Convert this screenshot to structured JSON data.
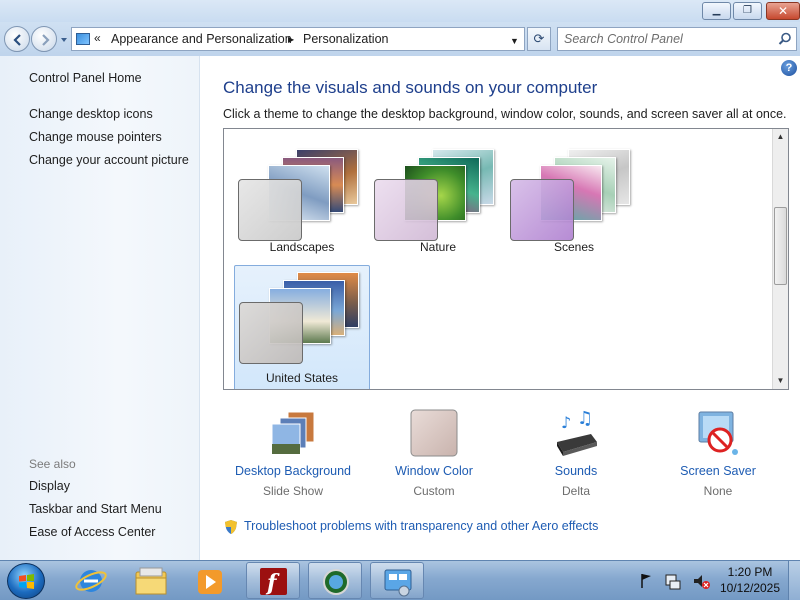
{
  "window": {
    "minimize_glyph": "▁",
    "maximize_glyph": "❐",
    "close_glyph": "✕"
  },
  "address_bar": {
    "chevrons": "«",
    "breadcrumb": [
      "Appearance and Personalization",
      "Personalization"
    ]
  },
  "search": {
    "placeholder": "Search Control Panel"
  },
  "sidebar": {
    "home": "Control Panel Home",
    "tasks": [
      "Change desktop icons",
      "Change mouse pointers",
      "Change your account picture"
    ],
    "see_also_title": "See also",
    "see_also": [
      "Display",
      "Taskbar and Start Menu",
      "Ease of Access Center"
    ]
  },
  "main": {
    "heading": "Change the visuals and sounds on your computer",
    "subtext": "Click a theme to change the desktop background, window color, sounds, and screen saver all at once.",
    "themes": [
      {
        "name": "Landscapes",
        "selected": false
      },
      {
        "name": "Nature",
        "selected": false
      },
      {
        "name": "Scenes",
        "selected": false
      },
      {
        "name": "United States",
        "selected": true
      }
    ],
    "options": [
      {
        "name": "Desktop Background",
        "value": "Slide Show",
        "icon": "desktop-background-icon"
      },
      {
        "name": "Window Color",
        "value": "Custom",
        "icon": "window-color-icon"
      },
      {
        "name": "Sounds",
        "value": "Delta",
        "icon": "sounds-icon"
      },
      {
        "name": "Screen Saver",
        "value": "None",
        "icon": "screen-saver-icon"
      }
    ],
    "troubleshoot": "Troubleshoot problems with transparency and other Aero effects",
    "help_glyph": "?"
  },
  "taskbar": {
    "apps": [
      {
        "name": "Internet Explorer",
        "icon": "internet-explorer-icon"
      },
      {
        "name": "Windows Explorer",
        "icon": "windows-explorer-icon"
      },
      {
        "name": "Windows Media Player",
        "icon": "media-player-icon"
      },
      {
        "name": "Adobe Flash",
        "icon": "flash-icon"
      },
      {
        "name": "Windows Update",
        "icon": "windows-update-icon"
      },
      {
        "name": "Control Panel",
        "icon": "control-panel-icon"
      }
    ],
    "time": "1:20 PM",
    "date": "10/12/2025"
  },
  "colors": {
    "link": "#1e5cb3",
    "heading": "#1e3f8c",
    "selection": "#d2e7fb"
  }
}
